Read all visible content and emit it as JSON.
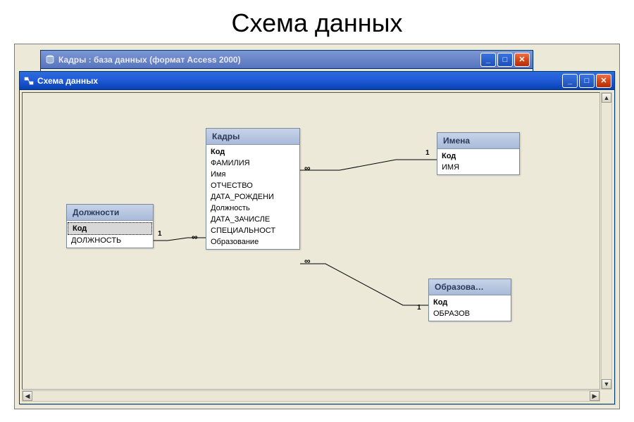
{
  "page": {
    "heading": "Схема данных"
  },
  "windows": {
    "db": {
      "title": "Кадры : база данных (формат Access 2000)",
      "icon": "database-icon"
    },
    "schema": {
      "title": "Схема данных",
      "icon": "relationship-icon"
    }
  },
  "tables": {
    "kadry": {
      "title": "Кадры",
      "fields": [
        "Код",
        "ФАМИЛИЯ",
        "Имя",
        "ОТЧЕСТВО",
        "ДАТА_РОЖДЕНИ",
        "Должность",
        "ДАТА_ЗАЧИСЛЕ",
        "СПЕЦИАЛЬНОСТ",
        "Образование"
      ],
      "pk_index": 0
    },
    "dolzhnosti": {
      "title": "Должности",
      "fields": [
        "Код",
        "ДОЛЖНОСТЬ"
      ],
      "pk_index": 0,
      "selected_index": 0
    },
    "imena": {
      "title": "Имена",
      "fields": [
        "Код",
        "ИМЯ"
      ],
      "pk_index": 0
    },
    "obrazovanie": {
      "title": "Образова…",
      "fields": [
        "Код",
        "ОБРАЗОВ"
      ],
      "pk_index": 0
    }
  },
  "relations": [
    {
      "from": "dolzhnosti",
      "to": "kadry",
      "one_label": "1",
      "many_label": "∞"
    },
    {
      "from": "imena",
      "to": "kadry",
      "one_label": "1",
      "many_label": "∞"
    },
    {
      "from": "obrazovanie",
      "to": "kadry",
      "one_label": "1",
      "many_label": "∞"
    }
  ],
  "buttons": {
    "minimize": "_",
    "maximize": "□",
    "close": "✕"
  },
  "scroll": {
    "up": "▲",
    "down": "▼",
    "left": "◀",
    "right": "▶"
  }
}
